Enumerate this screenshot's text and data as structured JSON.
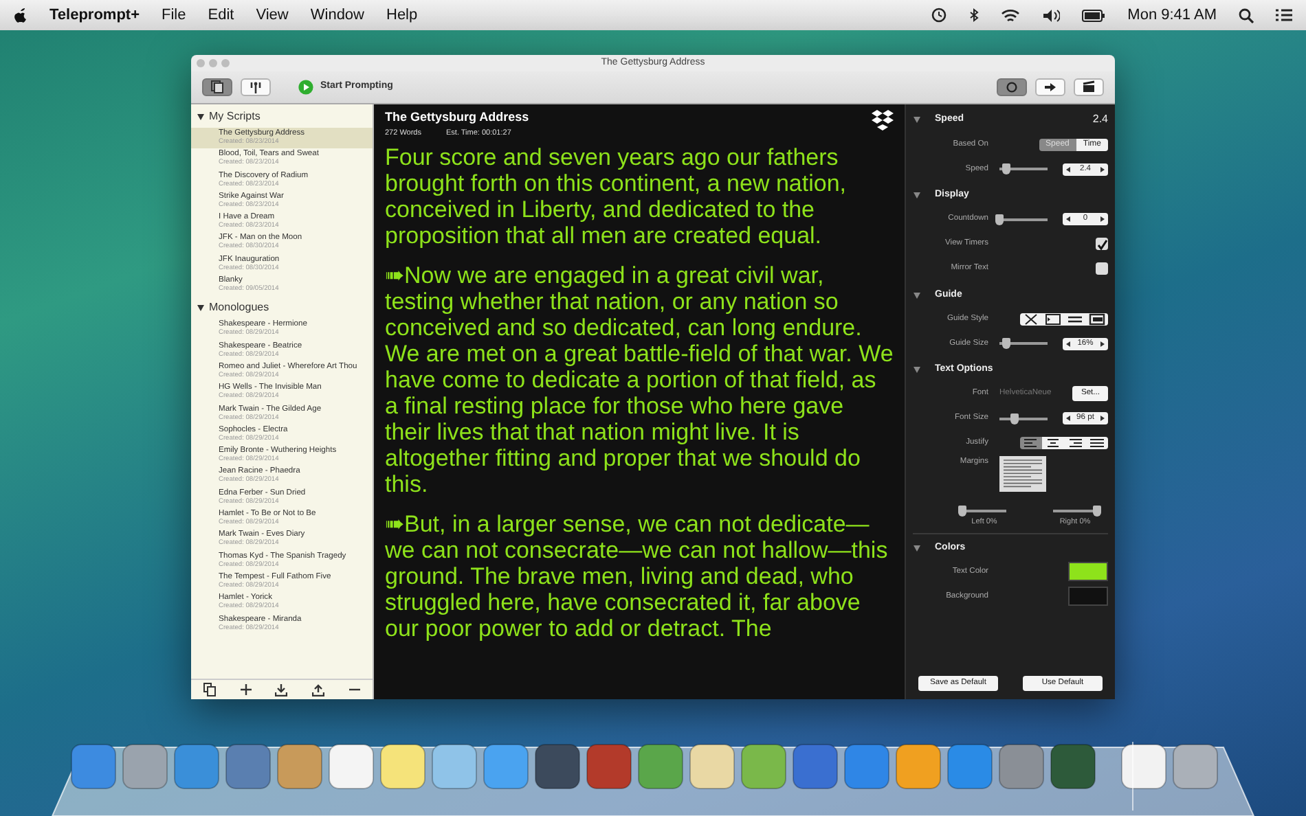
{
  "menubar": {
    "app": "Teleprompt+",
    "menus": [
      "File",
      "Edit",
      "View",
      "Window",
      "Help"
    ],
    "clock": "Mon 9:41 AM"
  },
  "window": {
    "title": "The Gettysburg Address",
    "toolbar": {
      "left": [
        {
          "kind": "scripts",
          "selected": true
        },
        {
          "kind": "remote",
          "selected": false
        }
      ],
      "start_label": "Start Prompting",
      "right": [
        {
          "kind": "record",
          "selected": true
        },
        {
          "kind": "arrow",
          "selected": false
        },
        {
          "kind": "clapper",
          "selected": false
        }
      ]
    }
  },
  "sidebar": {
    "groups": [
      {
        "label": "My Scripts",
        "expanded": true,
        "items": [
          {
            "title": "The Gettysburg Address",
            "created": "Created: 08/23/2014",
            "selected": true
          },
          {
            "title": "Blood, Toil, Tears and Sweat",
            "created": "Created: 08/23/2014",
            "selected": false
          },
          {
            "title": "The Discovery of Radium",
            "created": "Created: 08/23/2014",
            "selected": false
          },
          {
            "title": "Strike Against War",
            "created": "Created: 08/23/2014",
            "selected": false
          },
          {
            "title": "I Have a Dream",
            "created": "Created: 08/23/2014",
            "selected": false
          },
          {
            "title": "JFK - Man on the Moon",
            "created": "Created: 08/30/2014",
            "selected": false
          },
          {
            "title": "JFK Inauguration",
            "created": "Created: 08/30/2014",
            "selected": false
          },
          {
            "title": "Blanky",
            "created": "Created: 09/05/2014",
            "selected": false
          }
        ]
      },
      {
        "label": "Monologues",
        "expanded": true,
        "items": [
          {
            "title": "Shakespeare - Hermione",
            "created": "Created: 08/29/2014",
            "selected": false
          },
          {
            "title": "Shakespeare - Beatrice",
            "created": "Created: 08/29/2014",
            "selected": false
          },
          {
            "title": "Romeo and Juliet - Wherefore Art Thou",
            "created": "Created: 08/29/2014",
            "selected": false
          },
          {
            "title": "HG Wells - The Invisible Man",
            "created": "Created: 08/29/2014",
            "selected": false
          },
          {
            "title": "Mark Twain - The Gilded Age",
            "created": "Created: 08/29/2014",
            "selected": false
          },
          {
            "title": "Sophocles - Electra",
            "created": "Created: 08/29/2014",
            "selected": false
          },
          {
            "title": "Emily Bronte - Wuthering Heights",
            "created": "Created: 08/29/2014",
            "selected": false
          },
          {
            "title": "Jean Racine - Phaedra",
            "created": "Created: 08/29/2014",
            "selected": false
          },
          {
            "title": "Edna Ferber - Sun Dried",
            "created": "Created: 08/29/2014",
            "selected": false
          },
          {
            "title": "Hamlet - To Be or Not to Be",
            "created": "Created: 08/29/2014",
            "selected": false
          },
          {
            "title": "Mark Twain - Eves Diary",
            "created": "Created: 08/29/2014",
            "selected": false
          },
          {
            "title": "Thomas Kyd - The Spanish Tragedy",
            "created": "Created: 08/29/2014",
            "selected": false
          },
          {
            "title": "The Tempest - Full Fathom Five",
            "created": "Created: 08/29/2014",
            "selected": false
          },
          {
            "title": "Hamlet - Yorick",
            "created": "Created: 08/29/2014",
            "selected": false
          },
          {
            "title": "Shakespeare - Miranda",
            "created": "Created: 08/29/2014",
            "selected": false
          }
        ]
      }
    ]
  },
  "script": {
    "title": "The Gettysburg Address",
    "words": "272 Words",
    "est_time": "Est. Time: 00:01:27",
    "paragraphs": [
      "Four score and seven years ago our fathers brought forth on this continent, a new nation, conceived in Liberty, and dedicated to the proposition that all men are created equal.",
      "➠Now we are engaged in a great civil war, testing whether that nation, or any nation so conceived and so dedicated, can long endure. We are met on a great battle-field of that war. We have come to dedicate a portion of that field, as a final resting place for those who here gave their lives that that nation might live. It is altogether fitting and proper that we should do this.",
      "➠But, in a larger sense, we can not dedicate—we can not consecrate—we can not hallow—this ground. The brave men, living and dead, who struggled here, have consecrated it, far above our poor power to add or detract. The"
    ]
  },
  "settings": {
    "speed": {
      "label": "Speed",
      "expanded": true,
      "value": "2.4",
      "based_on_label": "Based On",
      "modes": [
        {
          "label": "Speed",
          "selected": true
        },
        {
          "label": "Time",
          "selected": false
        }
      ],
      "speed_label": "Speed",
      "speed_slider": {
        "level": 0.15
      },
      "speed_value": "2.4"
    },
    "display": {
      "label": "Display",
      "expanded": true,
      "countdown_label": "Countdown",
      "countdown_slider": {
        "level": 0.0
      },
      "countdown_value": "0",
      "view_timers_label": "View Timers",
      "view_timers_checked": true,
      "mirror_label": "Mirror Text",
      "mirror_checked": false
    },
    "guide": {
      "label": "Guide",
      "expanded": true,
      "style_label": "Guide Style",
      "styles": [
        {
          "kind": "cross"
        },
        {
          "kind": "pointer"
        },
        {
          "kind": "lines"
        },
        {
          "kind": "box"
        }
      ],
      "size_label": "Guide Size",
      "size_slider": {
        "level": 0.15
      },
      "size_value": "16%"
    },
    "text_options": {
      "label": "Text Options",
      "expanded": true,
      "font_label": "Font",
      "font_value": "HelveticaNeue",
      "set_button": "Set...",
      "size_label": "Font Size",
      "size_slider": {
        "level": 0.3
      },
      "size_value": "96 pt",
      "justify_label": "Justify",
      "justify": [
        {
          "kind": "left",
          "selected": true
        },
        {
          "kind": "center",
          "selected": false
        },
        {
          "kind": "right",
          "selected": false
        },
        {
          "kind": "full",
          "selected": false
        }
      ],
      "margins_label": "Margins",
      "left_slider": {
        "level": 0
      },
      "left_label": "Left 0%",
      "right_slider": {
        "level": 1
      },
      "right_label": "Right 0%"
    },
    "colors": {
      "label": "Colors",
      "expanded": true,
      "wells": [
        {
          "label": "Text Color",
          "color": "#8ee21b"
        },
        {
          "label": "Background",
          "color": "#111111"
        }
      ]
    },
    "buttons": [
      "Save as Default",
      "Use Default"
    ]
  }
}
